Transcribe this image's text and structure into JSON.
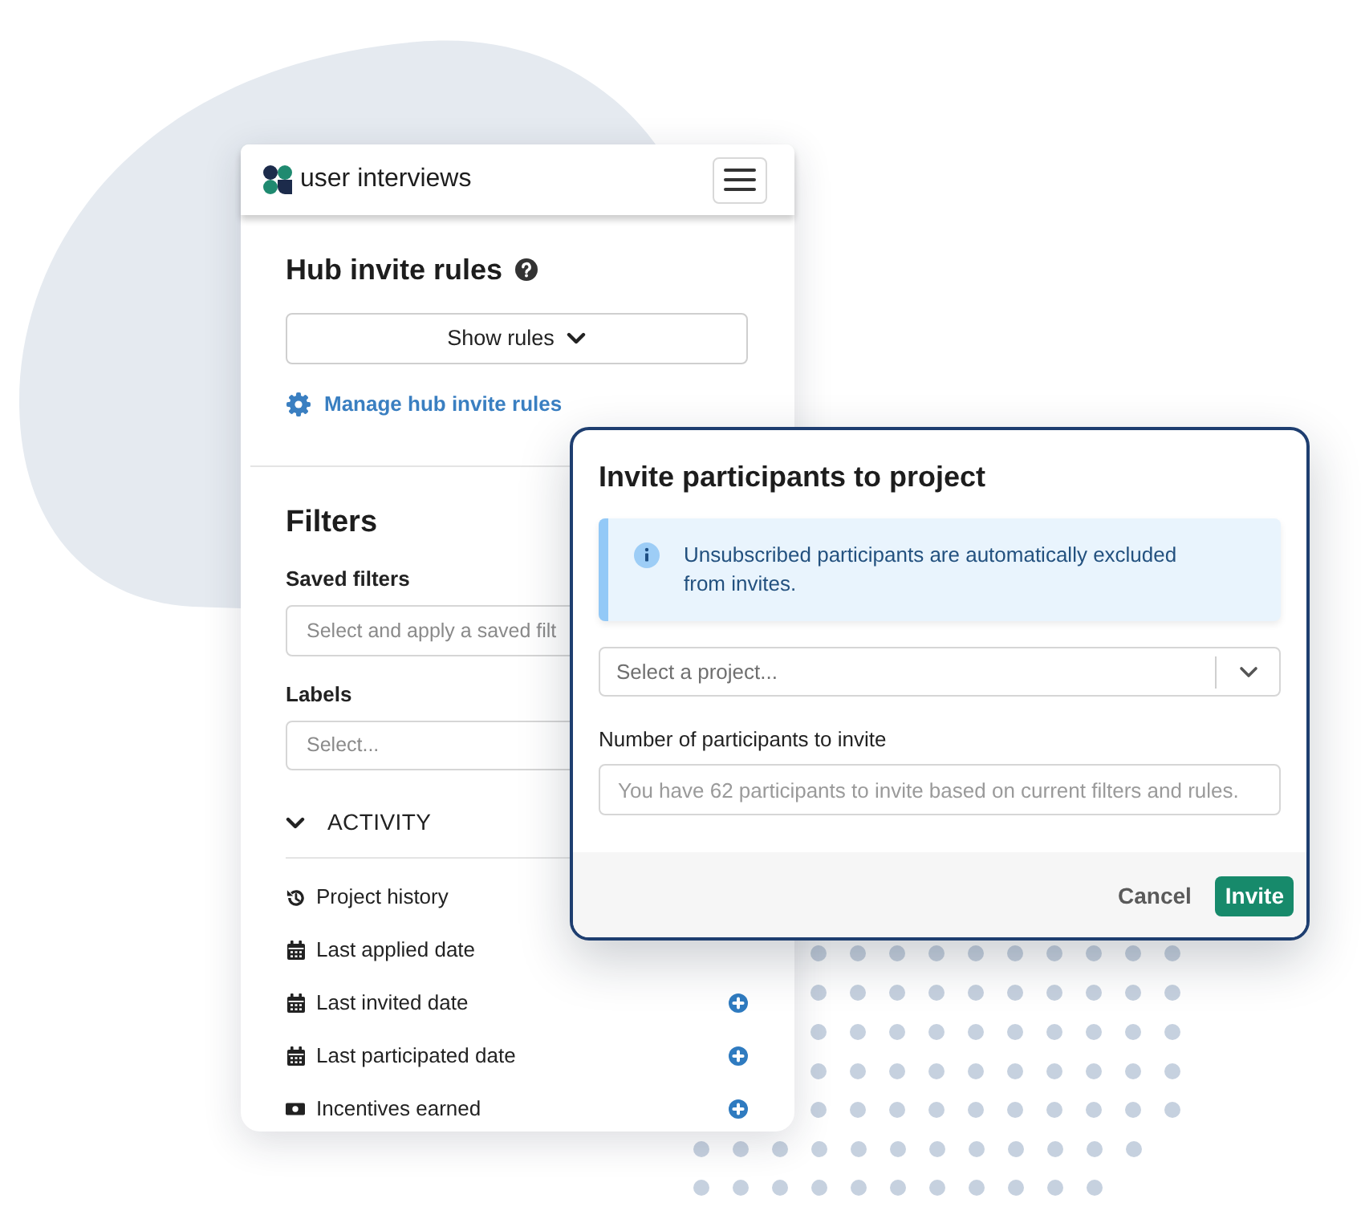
{
  "panel": {
    "logo_text": "user interviews",
    "hub_rules": {
      "title": "Hub invite rules",
      "show_rules_button": "Show rules",
      "manage_link": "Manage hub invite rules"
    },
    "filters": {
      "title": "Filters",
      "fields": [
        {
          "label": "Saved filters",
          "placeholder": "Select and apply a saved filt"
        },
        {
          "label": "Labels",
          "placeholder": "Select..."
        }
      ],
      "activity": {
        "title": "ACTIVITY",
        "expanded": true,
        "items": [
          {
            "label": "Project history",
            "kind": "history",
            "add_icon": false
          },
          {
            "label": "Last applied date",
            "kind": "date",
            "add_icon": false
          },
          {
            "label": "Last invited date",
            "kind": "date",
            "add_icon": true
          },
          {
            "label": "Last participated date",
            "kind": "date",
            "add_icon": true
          },
          {
            "label": "Incentives earned",
            "kind": "incentive",
            "add_icon": true
          }
        ]
      }
    }
  },
  "modal": {
    "title": "Invite participants to project",
    "notice": "Unsubscribed participants are automatically excluded from invites.",
    "project_select": {
      "placeholder": "Select a project..."
    },
    "participant_count": {
      "label": "Number of participants to invite",
      "placeholder": "You have 62 participants to invite based on current filters and rules."
    },
    "buttons": [
      {
        "label": "Cancel",
        "kind": "secondary"
      },
      {
        "label": "Invite",
        "kind": "primary"
      }
    ]
  }
}
